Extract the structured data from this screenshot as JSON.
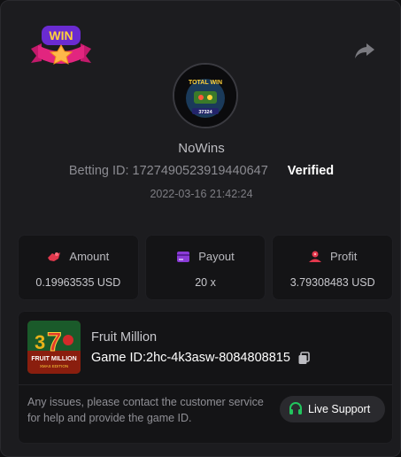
{
  "badge": {
    "text": "WIN"
  },
  "user": {
    "name": "NoWins",
    "betting_id_label": "Betting ID: 1727490523919440647",
    "verified": "Verified",
    "timestamp": "2022-03-16 21:42:24"
  },
  "avatar": {
    "text_top": "TOTAL WIN",
    "text_bottom": "37324"
  },
  "stats": [
    {
      "label": "Amount",
      "value": "0.19963535 USD",
      "icon": "amount-icon",
      "color": "#e2384d"
    },
    {
      "label": "Payout",
      "value": "20 x",
      "icon": "payout-card-icon",
      "color": "#8a3bd6"
    },
    {
      "label": "Profit",
      "value": "3.79308483 USD",
      "icon": "profit-icon",
      "color": "#e2384d"
    }
  ],
  "game": {
    "name": "Fruit Million",
    "id_label": "Game ID:2hc-4k3asw-8084808815",
    "thumb_title": "FRUIT MILLION",
    "thumb_subtitle": "XMAS EDITION"
  },
  "support": {
    "message": "Any issues, please contact the customer service for help and provide the game ID.",
    "button_label": "Live Support"
  },
  "colors": {
    "accent_green": "#22c55e",
    "red": "#e2384d",
    "purple": "#8a3bd6"
  }
}
